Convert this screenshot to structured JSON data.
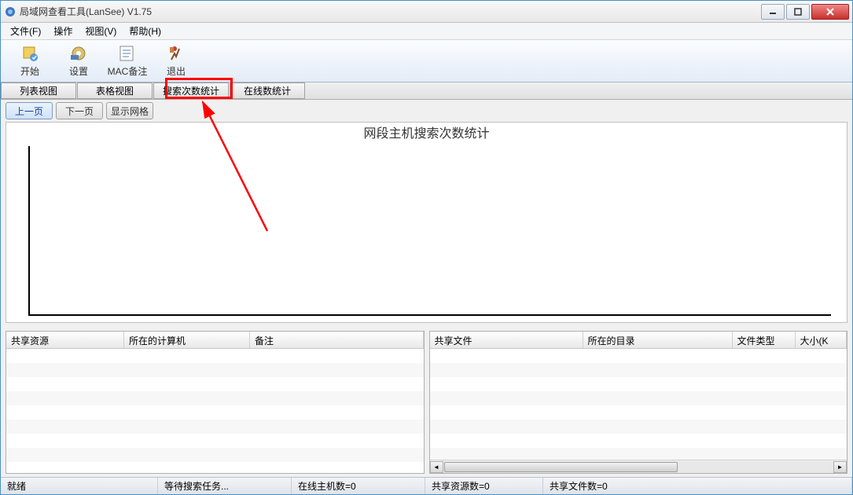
{
  "window": {
    "title": "局域网查看工具(LanSee) V1.75"
  },
  "menu": {
    "file": "文件(F)",
    "operate": "操作",
    "view": "视图(V)",
    "help": "帮助(H)"
  },
  "toolbar": {
    "start": "开始",
    "settings": "设置",
    "mac": "MAC备注",
    "exit": "退出"
  },
  "tabs": {
    "list_view": "列表视图",
    "table_view": "表格视图",
    "search_stats": "搜索次数统计",
    "online_stats": "在线数统计"
  },
  "controls": {
    "prev": "上一页",
    "next": "下一页",
    "grid": "显示网格"
  },
  "chart": {
    "title": "网段主机搜索次数统计"
  },
  "left_panel": {
    "col1": "共享资源",
    "col2": "所在的计算机",
    "col3": "备注"
  },
  "right_panel": {
    "col1": "共享文件",
    "col2": "所在的目录",
    "col3": "文件类型",
    "col4": "大小(K"
  },
  "status": {
    "ready": "就绪",
    "waiting": "等待搜索任务...",
    "online": "在线主机数=0",
    "shared_res": "共享资源数=0",
    "shared_files": "共享文件数=0"
  }
}
